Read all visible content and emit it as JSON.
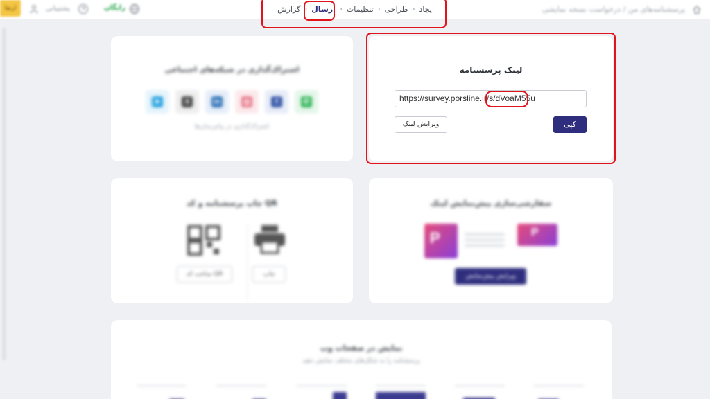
{
  "topbar": {
    "title": "پرسشنامه‌های من / درخواست نسخه نمایشی",
    "account_label": "پشتیبانی",
    "plan_label": "رایگان",
    "badge_label": "ارتقا"
  },
  "steps": [
    "ایجاد",
    "طراحی",
    "تنظیمات",
    "ارسال",
    "گزارش"
  ],
  "active_step": "ارسال",
  "link_card": {
    "title": "لینک پرسشنامه",
    "url": "https://survey.porsline.ir/s/dVoaM55u",
    "copy_label": "کپی",
    "edit_label": "ویرایش لینک"
  },
  "share_card": {
    "title": "اشتراک‌گذاری در شبکه‌های اجتماعی",
    "note": "اشتراک‌گذاری در پیام‌رسان‌ها",
    "networks": [
      {
        "name": "telegram-icon",
        "glyph": "➤",
        "color": "#2aa3e0",
        "bg": "#e6f4fb"
      },
      {
        "name": "x-icon",
        "glyph": "X",
        "color": "#444444",
        "bg": "#eeeeee"
      },
      {
        "name": "linkedin-icon",
        "glyph": "in",
        "color": "#2a6fb5",
        "bg": "#e6eef8"
      },
      {
        "name": "instagram-icon",
        "glyph": "◎",
        "color": "#e87a8a",
        "bg": "#fbe9ec"
      },
      {
        "name": "facebook-icon",
        "glyph": "f",
        "color": "#3a5aa8",
        "bg": "#e7ecf7"
      },
      {
        "name": "whatsapp-icon",
        "glyph": "✆",
        "color": "#2fb455",
        "bg": "#e5f6ea"
      }
    ]
  },
  "preview_card": {
    "title": "سفارشی‌سازی پیش‌نمایش لینک",
    "button_label": "ویرایش پیش‌نمایش"
  },
  "print_card": {
    "title": "چاپ پرسشنامه و کد QR",
    "print_label": "چاپ",
    "qr_label": "ساخت کد QR"
  },
  "embed_card": {
    "title": "نمایش در صفحات وب",
    "subtitle": "پرسشنامه را به شکل‌های مختلف نمایش دهید"
  },
  "colors": {
    "primary": "#2f2e7e",
    "highlight": "#e2141b",
    "background": "#eef0f3"
  }
}
